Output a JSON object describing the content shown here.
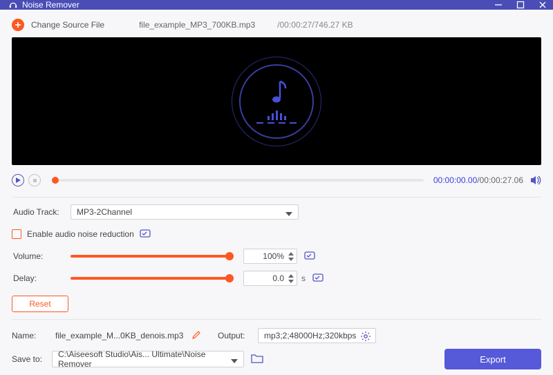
{
  "titlebar": {
    "title": "Noise Remover"
  },
  "source": {
    "change_label": "Change Source File",
    "filename": "file_example_MP3_700KB.mp3",
    "info": "/00:00:27/746.27 KB"
  },
  "playback": {
    "current": "00:00:00.00",
    "total": "/00:00:27.06"
  },
  "controls": {
    "audio_track_label": "Audio Track:",
    "audio_track_value": "MP3-2Channel",
    "noise_reduction_label": "Enable audio noise reduction",
    "volume_label": "Volume:",
    "volume_value": "100%",
    "delay_label": "Delay:",
    "delay_value": "0.0",
    "delay_unit": "s",
    "reset_label": "Reset"
  },
  "output": {
    "name_label": "Name:",
    "name_value": "file_example_M...0KB_denois.mp3",
    "output_label": "Output:",
    "output_value": "mp3;2;48000Hz;320kbps",
    "save_label": "Save to:",
    "save_value": "C:\\Aiseesoft Studio\\Ais... Ultimate\\Noise Remover",
    "export_label": "Export"
  },
  "colors": {
    "accent": "#ff5722",
    "primary": "#5659d8"
  }
}
